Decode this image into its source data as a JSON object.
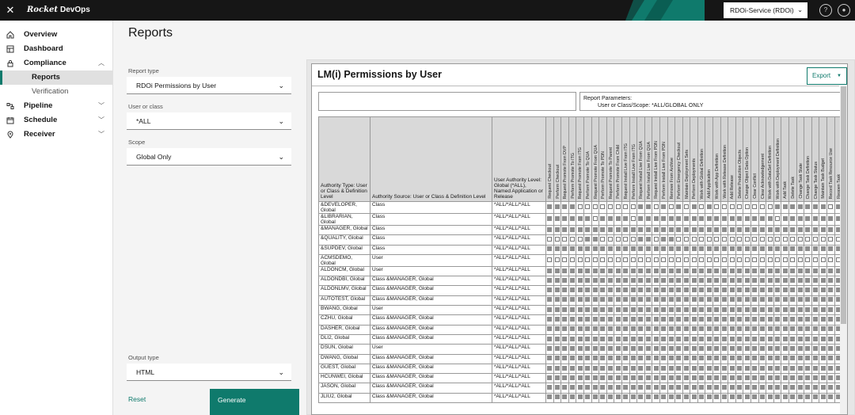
{
  "header": {
    "close_icon": "close-icon",
    "brand": "Rocket",
    "product": "DevOps",
    "service": "RDOi-Service (RDOi)",
    "help_icon": "help-icon",
    "user_icon": "user-icon"
  },
  "sidebar": {
    "items": [
      {
        "label": "Overview",
        "icon": "home-icon"
      },
      {
        "label": "Dashboard",
        "icon": "dashboard-icon"
      },
      {
        "label": "Compliance",
        "icon": "lock-icon",
        "expanded": true,
        "children": [
          {
            "label": "Reports",
            "active": true
          },
          {
            "label": "Verification"
          }
        ]
      },
      {
        "label": "Pipeline",
        "icon": "pipeline-icon"
      },
      {
        "label": "Schedule",
        "icon": "calendar-icon"
      },
      {
        "label": "Receiver",
        "icon": "location-icon"
      }
    ]
  },
  "page": {
    "title": "Reports"
  },
  "form": {
    "report_type": {
      "label": "Report type",
      "value": "RDOi Permissions by User"
    },
    "user_or_class": {
      "label": "User or class",
      "value": "*ALL"
    },
    "scope": {
      "label": "Scope",
      "value": "Global Only"
    },
    "output_type": {
      "label": "Output type",
      "value": "HTML"
    },
    "reset_label": "Reset",
    "generate_label": "Generate"
  },
  "report": {
    "title": "LM(i) Permissions by User",
    "export_label": "Export",
    "params_line1": "Report Parameters:",
    "params_line2": "User or Class/Scope: *ALL/GLOBAL ONLY",
    "columns": {
      "authority_type": "Authority Type: User or Class & Definition Level",
      "authority_source": "Authority Source: User or Class & Definition Level",
      "user_authority": "User Authority Level: Global (*ALL), Named Application or Release"
    },
    "permissions": [
      "Request Checkout",
      "Perform Checkout",
      "Request Promote From DVP",
      "Perform Promote To ITG",
      "Request Promote From ITG",
      "Perform Promote To QUA",
      "Request Promote From QUA",
      "Perform Promote To PDN",
      "Request Promote To Parent",
      "Perform Promote From Child",
      "Request Install Live From ITG",
      "Perform Install Live From ITG",
      "Request Install Live From QUA",
      "Perform Install Live From QUA",
      "Request Install Live From PDN",
      "Perform Install Live From PDN",
      "Remove From Archive",
      "Perform Emergency Checkout",
      "Maintain Deployment Sets",
      "Perform Deployments",
      "Work with Global Definition",
      "Add Application",
      "Work with App Definition",
      "Work with Release Definition",
      "Add Release",
      "Delete Production Objects",
      "Change Object Data Option",
      "Clear Conflict",
      "Clear Acknowledgement",
      "Work with DataSet Definition",
      "Work with Deployment Definition",
      "Add Task",
      "Delete Task",
      "Change Task State",
      "Change Task Definition",
      "Change Task Status",
      "Maintain Task Budget",
      "Record Task Resource Use",
      "Reopen Task"
    ],
    "rows": [
      {
        "type": "&DEVELOPER, Global",
        "source": "Class",
        "level": "*ALL/*ALL/*ALL",
        "marks": "111100000000110101010100000000111111101"
      },
      {
        "type": "&LIBRARIAN, Global",
        "source": "Class",
        "level": "*ALL/*ALL/*ALL",
        "marks": "111111011110111111111111111111011111111"
      },
      {
        "type": "&MANAGER, Global",
        "source": "Class",
        "level": "*ALL/*ALL/*ALL",
        "marks": "111111111111111111111111111111111111111"
      },
      {
        "type": "&QUALITY, Global",
        "source": "Class",
        "level": "*ALL/*ALL/*ALL",
        "marks": "000001100000110110000000000000000000000"
      },
      {
        "type": "&SUPDEV, Global",
        "source": "Class",
        "level": "*ALL/*ALL/*ALL",
        "marks": "111111111111111111111111111111111111111"
      },
      {
        "type": "ACMSDEMO, Global",
        "source": "User",
        "level": "*ALL/*ALL/*ALL",
        "marks": "000000000000000000000000000000000000000"
      },
      {
        "type": "ALDONCM, Global",
        "source": "User",
        "level": "*ALL/*ALL/*ALL",
        "marks": "111111111111111111111111111111111111111"
      },
      {
        "type": "ALDONDBI, Global",
        "source": "Class &MANAGER, Global",
        "level": "*ALL/*ALL/*ALL",
        "marks": "111111111111111111111111111111111111111"
      },
      {
        "type": "ALDONLMV, Global",
        "source": "Class &MANAGER, Global",
        "level": "*ALL/*ALL/*ALL",
        "marks": "111111111111111111111111111111111111111"
      },
      {
        "type": "AUTOTEST, Global",
        "source": "Class &MANAGER, Global",
        "level": "*ALL/*ALL/*ALL",
        "marks": "111111111111111111111111111111111111111"
      },
      {
        "type": "BWANG, Global",
        "source": "User",
        "level": "*ALL/*ALL/*ALL",
        "marks": "111111111111111111111111111111111111111"
      },
      {
        "type": "CZHU, Global",
        "source": "Class &MANAGER, Global",
        "level": "*ALL/*ALL/*ALL",
        "marks": "111111111111111111111111111111111111111"
      },
      {
        "type": "DASHER, Global",
        "source": "Class &MANAGER, Global",
        "level": "*ALL/*ALL/*ALL",
        "marks": "111111111111111111111111111111111111111"
      },
      {
        "type": "DLI2, Global",
        "source": "Class &MANAGER, Global",
        "level": "*ALL/*ALL/*ALL",
        "marks": "111111111111111111111111111111111111111"
      },
      {
        "type": "DSUN, Global",
        "source": "User",
        "level": "*ALL/*ALL/*ALL",
        "marks": "111111111111111111111111111111111111111"
      },
      {
        "type": "DWANG, Global",
        "source": "Class &MANAGER, Global",
        "level": "*ALL/*ALL/*ALL",
        "marks": "111111111111111111111111111111111111111"
      },
      {
        "type": "GUEST, Global",
        "source": "Class &MANAGER, Global",
        "level": "*ALL/*ALL/*ALL",
        "marks": "111111111111111111111111111111111111111"
      },
      {
        "type": "HCUNWEI, Global",
        "source": "Class &MANAGER, Global",
        "level": "*ALL/*ALL/*ALL",
        "marks": "111111111111111111111111111111111111111"
      },
      {
        "type": "JASON, Global",
        "source": "Class &MANAGER, Global",
        "level": "*ALL/*ALL/*ALL",
        "marks": "111111111111111111111111111111111111111"
      },
      {
        "type": "JLIU2, Global",
        "source": "Class &MANAGER, Global",
        "level": "*ALL/*ALL/*ALL",
        "marks": "111111111111111111111111111111111111111"
      }
    ]
  }
}
